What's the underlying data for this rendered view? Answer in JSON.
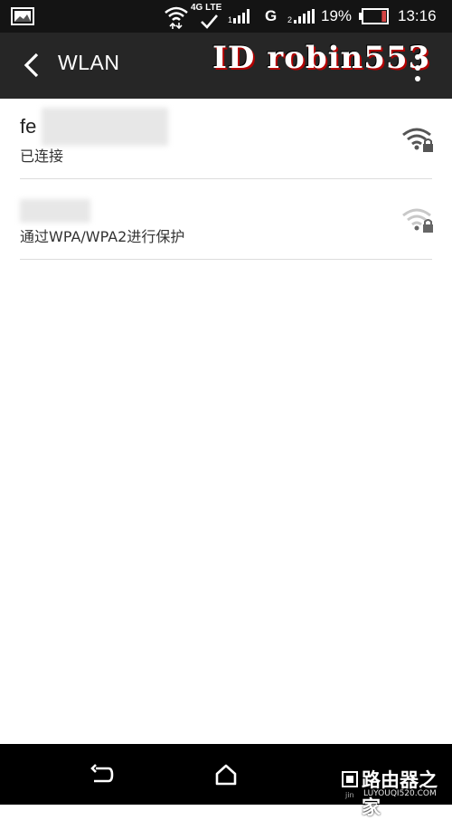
{
  "status_bar": {
    "network_type": "4G LTE",
    "network_g": "G",
    "battery_percent": "19%",
    "battery_level": 0.19,
    "time": "13:16"
  },
  "app_bar": {
    "title": "WLAN",
    "watermark": "ID robin553"
  },
  "networks": [
    {
      "ssid_visible": "fe",
      "status": "已连接",
      "secured": true,
      "strength": "full"
    },
    {
      "ssid_visible": "",
      "status": "通过WPA/WPA2进行保护",
      "secured": true,
      "strength": "weak"
    }
  ],
  "nav_bar": {
    "watermark_main": "路由器之家",
    "watermark_sub": "LUYOUQI520.COM",
    "watermark_prefix": "jin"
  },
  "colors": {
    "status_bar_bg": "#141414",
    "app_bar_bg": "#262626",
    "nav_bar_bg": "#000000",
    "divider": "#dcdcdc",
    "battery_low": "#d44343"
  }
}
